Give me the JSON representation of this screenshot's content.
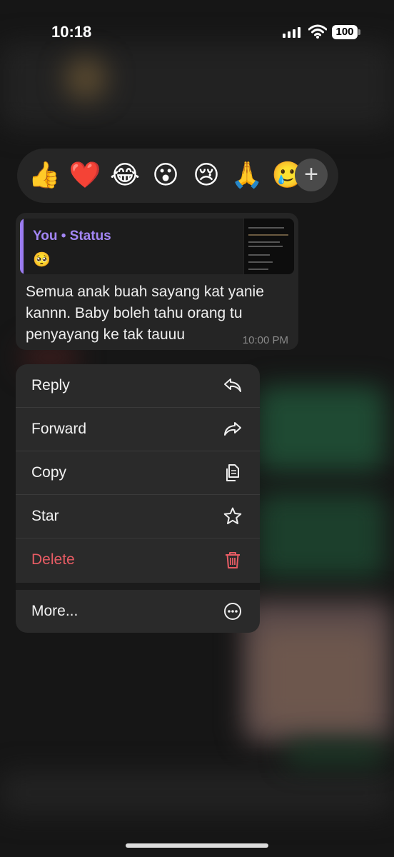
{
  "status_bar": {
    "time": "10:18",
    "battery": "100"
  },
  "reactions": {
    "emojis": [
      "👍",
      "❤️",
      "😂",
      "😮",
      "😢",
      "🙏",
      "🥲"
    ],
    "selected_index": 1,
    "more_icon": "plus-icon"
  },
  "message": {
    "quote_title": "You • Status",
    "quote_emoji": "🥺",
    "text": "Semua anak buah sayang kat yanie kannn. Baby boleh tahu orang tu penyayang ke tak tauuu",
    "time": "10:00 PM"
  },
  "menu": {
    "items": [
      {
        "label": "Reply",
        "icon": "reply-icon"
      },
      {
        "label": "Forward",
        "icon": "forward-icon"
      },
      {
        "label": "Copy",
        "icon": "copy-icon"
      },
      {
        "label": "Star",
        "icon": "star-icon"
      },
      {
        "label": "Delete",
        "icon": "trash-icon",
        "color": "#e85c64"
      }
    ],
    "more_label": "More...",
    "more_icon": "ellipsis-circle-icon"
  }
}
